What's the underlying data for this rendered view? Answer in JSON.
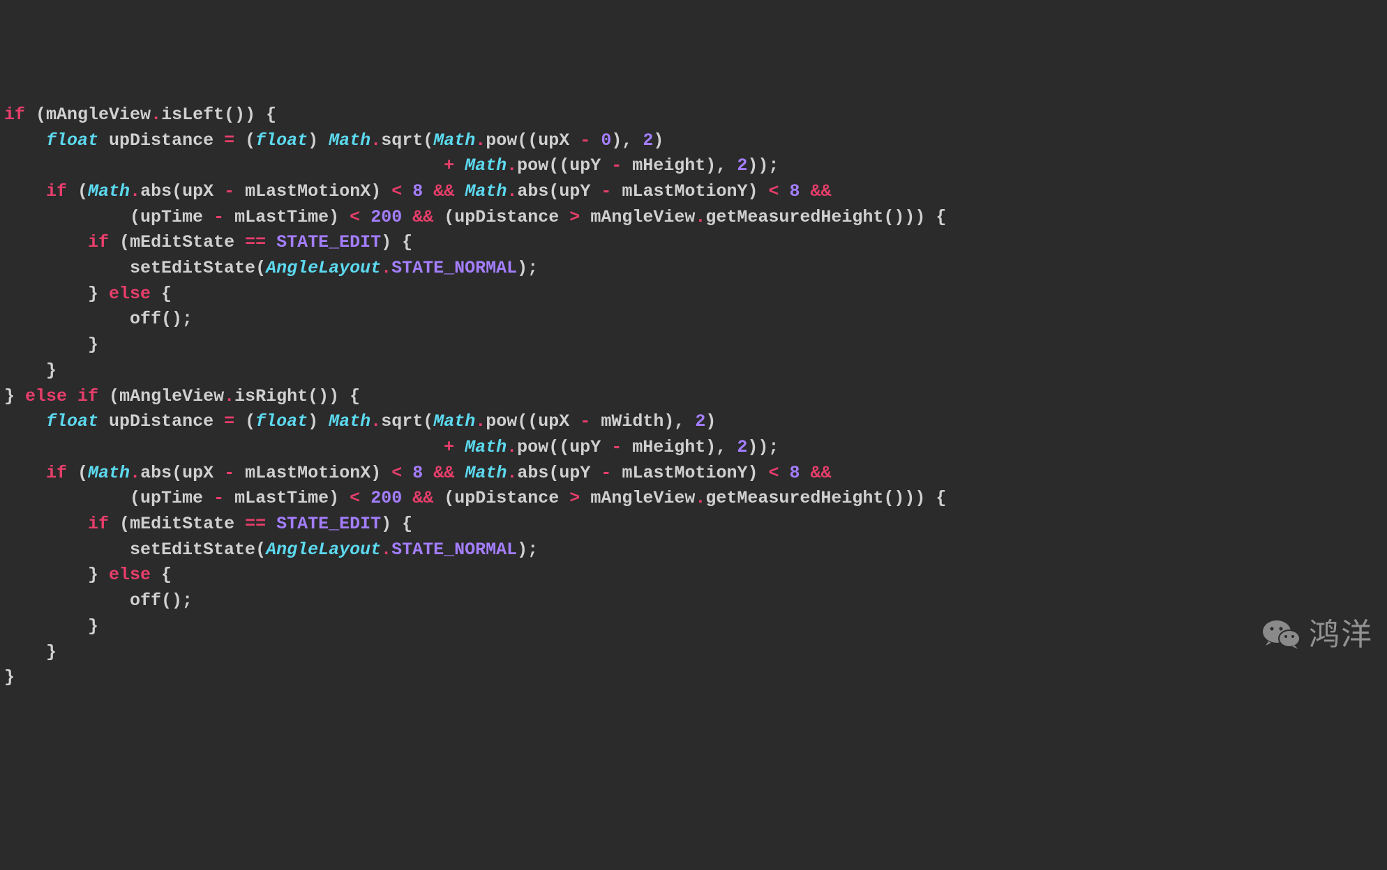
{
  "code": {
    "lines": [
      [
        {
          "c": "kw",
          "t": "if"
        },
        {
          "c": "pn",
          "t": " ("
        },
        {
          "c": "id",
          "t": "mAngleView"
        },
        {
          "c": "op",
          "t": "."
        },
        {
          "c": "id",
          "t": "isLeft"
        },
        {
          "c": "pn",
          "t": "()) {"
        }
      ],
      [
        {
          "c": "pn",
          "t": "    "
        },
        {
          "c": "kwit",
          "t": "float"
        },
        {
          "c": "pn",
          "t": " "
        },
        {
          "c": "id",
          "t": "upDistance"
        },
        {
          "c": "pn",
          "t": " "
        },
        {
          "c": "op",
          "t": "="
        },
        {
          "c": "pn",
          "t": " ("
        },
        {
          "c": "kwit",
          "t": "float"
        },
        {
          "c": "pn",
          "t": ") "
        },
        {
          "c": "kwit",
          "t": "Math"
        },
        {
          "c": "op",
          "t": "."
        },
        {
          "c": "id",
          "t": "sqrt"
        },
        {
          "c": "pn",
          "t": "("
        },
        {
          "c": "kwit",
          "t": "Math"
        },
        {
          "c": "op",
          "t": "."
        },
        {
          "c": "id",
          "t": "pow"
        },
        {
          "c": "pn",
          "t": "(("
        },
        {
          "c": "id",
          "t": "upX"
        },
        {
          "c": "pn",
          "t": " "
        },
        {
          "c": "op",
          "t": "-"
        },
        {
          "c": "pn",
          "t": " "
        },
        {
          "c": "num",
          "t": "0"
        },
        {
          "c": "pn",
          "t": "), "
        },
        {
          "c": "num",
          "t": "2"
        },
        {
          "c": "pn",
          "t": ")"
        }
      ],
      [
        {
          "c": "pn",
          "t": "                                          "
        },
        {
          "c": "op",
          "t": "+"
        },
        {
          "c": "pn",
          "t": " "
        },
        {
          "c": "kwit",
          "t": "Math"
        },
        {
          "c": "op",
          "t": "."
        },
        {
          "c": "id",
          "t": "pow"
        },
        {
          "c": "pn",
          "t": "(("
        },
        {
          "c": "id",
          "t": "upY"
        },
        {
          "c": "pn",
          "t": " "
        },
        {
          "c": "op",
          "t": "-"
        },
        {
          "c": "pn",
          "t": " "
        },
        {
          "c": "id",
          "t": "mHeight"
        },
        {
          "c": "pn",
          "t": "), "
        },
        {
          "c": "num",
          "t": "2"
        },
        {
          "c": "pn",
          "t": "));"
        }
      ],
      [
        {
          "c": "pn",
          "t": "    "
        },
        {
          "c": "kw",
          "t": "if"
        },
        {
          "c": "pn",
          "t": " ("
        },
        {
          "c": "kwit",
          "t": "Math"
        },
        {
          "c": "op",
          "t": "."
        },
        {
          "c": "id",
          "t": "abs"
        },
        {
          "c": "pn",
          "t": "("
        },
        {
          "c": "id",
          "t": "upX"
        },
        {
          "c": "pn",
          "t": " "
        },
        {
          "c": "op",
          "t": "-"
        },
        {
          "c": "pn",
          "t": " "
        },
        {
          "c": "id",
          "t": "mLastMotionX"
        },
        {
          "c": "pn",
          "t": ") "
        },
        {
          "c": "op",
          "t": "<"
        },
        {
          "c": "pn",
          "t": " "
        },
        {
          "c": "num",
          "t": "8"
        },
        {
          "c": "pn",
          "t": " "
        },
        {
          "c": "op",
          "t": "&&"
        },
        {
          "c": "pn",
          "t": " "
        },
        {
          "c": "kwit",
          "t": "Math"
        },
        {
          "c": "op",
          "t": "."
        },
        {
          "c": "id",
          "t": "abs"
        },
        {
          "c": "pn",
          "t": "("
        },
        {
          "c": "id",
          "t": "upY"
        },
        {
          "c": "pn",
          "t": " "
        },
        {
          "c": "op",
          "t": "-"
        },
        {
          "c": "pn",
          "t": " "
        },
        {
          "c": "id",
          "t": "mLastMotionY"
        },
        {
          "c": "pn",
          "t": ") "
        },
        {
          "c": "op",
          "t": "<"
        },
        {
          "c": "pn",
          "t": " "
        },
        {
          "c": "num",
          "t": "8"
        },
        {
          "c": "pn",
          "t": " "
        },
        {
          "c": "op",
          "t": "&&"
        }
      ],
      [
        {
          "c": "pn",
          "t": "            ("
        },
        {
          "c": "id",
          "t": "upTime"
        },
        {
          "c": "pn",
          "t": " "
        },
        {
          "c": "op",
          "t": "-"
        },
        {
          "c": "pn",
          "t": " "
        },
        {
          "c": "id",
          "t": "mLastTime"
        },
        {
          "c": "pn",
          "t": ") "
        },
        {
          "c": "op",
          "t": "<"
        },
        {
          "c": "pn",
          "t": " "
        },
        {
          "c": "num",
          "t": "200"
        },
        {
          "c": "pn",
          "t": " "
        },
        {
          "c": "op",
          "t": "&&"
        },
        {
          "c": "pn",
          "t": " ("
        },
        {
          "c": "id",
          "t": "upDistance"
        },
        {
          "c": "pn",
          "t": " "
        },
        {
          "c": "op",
          "t": ">"
        },
        {
          "c": "pn",
          "t": " "
        },
        {
          "c": "id",
          "t": "mAngleView"
        },
        {
          "c": "op",
          "t": "."
        },
        {
          "c": "id",
          "t": "getMeasuredHeight"
        },
        {
          "c": "pn",
          "t": "())) {"
        }
      ],
      [
        {
          "c": "pn",
          "t": "        "
        },
        {
          "c": "kw",
          "t": "if"
        },
        {
          "c": "pn",
          "t": " ("
        },
        {
          "c": "id",
          "t": "mEditState"
        },
        {
          "c": "pn",
          "t": " "
        },
        {
          "c": "op",
          "t": "=="
        },
        {
          "c": "pn",
          "t": " "
        },
        {
          "c": "const",
          "t": "STATE_EDIT"
        },
        {
          "c": "pn",
          "t": ") {"
        }
      ],
      [
        {
          "c": "pn",
          "t": "            "
        },
        {
          "c": "id",
          "t": "setEditState"
        },
        {
          "c": "pn",
          "t": "("
        },
        {
          "c": "kwit",
          "t": "AngleLayout"
        },
        {
          "c": "op",
          "t": "."
        },
        {
          "c": "const",
          "t": "STATE_NORMAL"
        },
        {
          "c": "pn",
          "t": ");"
        }
      ],
      [
        {
          "c": "pn",
          "t": "        } "
        },
        {
          "c": "kw",
          "t": "else"
        },
        {
          "c": "pn",
          "t": " {"
        }
      ],
      [
        {
          "c": "pn",
          "t": "            "
        },
        {
          "c": "id",
          "t": "off"
        },
        {
          "c": "pn",
          "t": "();"
        }
      ],
      [
        {
          "c": "pn",
          "t": "        }"
        }
      ],
      [
        {
          "c": "pn",
          "t": "    }"
        }
      ],
      [
        {
          "c": "pn",
          "t": "} "
        },
        {
          "c": "kw",
          "t": "else if"
        },
        {
          "c": "pn",
          "t": " ("
        },
        {
          "c": "id",
          "t": "mAngleView"
        },
        {
          "c": "op",
          "t": "."
        },
        {
          "c": "id",
          "t": "isRight"
        },
        {
          "c": "pn",
          "t": "()) {"
        }
      ],
      [
        {
          "c": "pn",
          "t": "    "
        },
        {
          "c": "kwit",
          "t": "float"
        },
        {
          "c": "pn",
          "t": " "
        },
        {
          "c": "id",
          "t": "upDistance"
        },
        {
          "c": "pn",
          "t": " "
        },
        {
          "c": "op",
          "t": "="
        },
        {
          "c": "pn",
          "t": " ("
        },
        {
          "c": "kwit",
          "t": "float"
        },
        {
          "c": "pn",
          "t": ") "
        },
        {
          "c": "kwit",
          "t": "Math"
        },
        {
          "c": "op",
          "t": "."
        },
        {
          "c": "id",
          "t": "sqrt"
        },
        {
          "c": "pn",
          "t": "("
        },
        {
          "c": "kwit",
          "t": "Math"
        },
        {
          "c": "op",
          "t": "."
        },
        {
          "c": "id",
          "t": "pow"
        },
        {
          "c": "pn",
          "t": "(("
        },
        {
          "c": "id",
          "t": "upX"
        },
        {
          "c": "pn",
          "t": " "
        },
        {
          "c": "op",
          "t": "-"
        },
        {
          "c": "pn",
          "t": " "
        },
        {
          "c": "id",
          "t": "mWidth"
        },
        {
          "c": "pn",
          "t": "), "
        },
        {
          "c": "num",
          "t": "2"
        },
        {
          "c": "pn",
          "t": ")"
        }
      ],
      [
        {
          "c": "pn",
          "t": "                                          "
        },
        {
          "c": "op",
          "t": "+"
        },
        {
          "c": "pn",
          "t": " "
        },
        {
          "c": "kwit",
          "t": "Math"
        },
        {
          "c": "op",
          "t": "."
        },
        {
          "c": "id",
          "t": "pow"
        },
        {
          "c": "pn",
          "t": "(("
        },
        {
          "c": "id",
          "t": "upY"
        },
        {
          "c": "pn",
          "t": " "
        },
        {
          "c": "op",
          "t": "-"
        },
        {
          "c": "pn",
          "t": " "
        },
        {
          "c": "id",
          "t": "mHeight"
        },
        {
          "c": "pn",
          "t": "), "
        },
        {
          "c": "num",
          "t": "2"
        },
        {
          "c": "pn",
          "t": "));"
        }
      ],
      [
        {
          "c": "pn",
          "t": "    "
        },
        {
          "c": "kw",
          "t": "if"
        },
        {
          "c": "pn",
          "t": " ("
        },
        {
          "c": "kwit",
          "t": "Math"
        },
        {
          "c": "op",
          "t": "."
        },
        {
          "c": "id",
          "t": "abs"
        },
        {
          "c": "pn",
          "t": "("
        },
        {
          "c": "id",
          "t": "upX"
        },
        {
          "c": "pn",
          "t": " "
        },
        {
          "c": "op",
          "t": "-"
        },
        {
          "c": "pn",
          "t": " "
        },
        {
          "c": "id",
          "t": "mLastMotionX"
        },
        {
          "c": "pn",
          "t": ") "
        },
        {
          "c": "op",
          "t": "<"
        },
        {
          "c": "pn",
          "t": " "
        },
        {
          "c": "num",
          "t": "8"
        },
        {
          "c": "pn",
          "t": " "
        },
        {
          "c": "op",
          "t": "&&"
        },
        {
          "c": "pn",
          "t": " "
        },
        {
          "c": "kwit",
          "t": "Math"
        },
        {
          "c": "op",
          "t": "."
        },
        {
          "c": "id",
          "t": "abs"
        },
        {
          "c": "pn",
          "t": "("
        },
        {
          "c": "id",
          "t": "upY"
        },
        {
          "c": "pn",
          "t": " "
        },
        {
          "c": "op",
          "t": "-"
        },
        {
          "c": "pn",
          "t": " "
        },
        {
          "c": "id",
          "t": "mLastMotionY"
        },
        {
          "c": "pn",
          "t": ") "
        },
        {
          "c": "op",
          "t": "<"
        },
        {
          "c": "pn",
          "t": " "
        },
        {
          "c": "num",
          "t": "8"
        },
        {
          "c": "pn",
          "t": " "
        },
        {
          "c": "op",
          "t": "&&"
        }
      ],
      [
        {
          "c": "pn",
          "t": "            ("
        },
        {
          "c": "id",
          "t": "upTime"
        },
        {
          "c": "pn",
          "t": " "
        },
        {
          "c": "op",
          "t": "-"
        },
        {
          "c": "pn",
          "t": " "
        },
        {
          "c": "id",
          "t": "mLastTime"
        },
        {
          "c": "pn",
          "t": ") "
        },
        {
          "c": "op",
          "t": "<"
        },
        {
          "c": "pn",
          "t": " "
        },
        {
          "c": "num",
          "t": "200"
        },
        {
          "c": "pn",
          "t": " "
        },
        {
          "c": "op",
          "t": "&&"
        },
        {
          "c": "pn",
          "t": " ("
        },
        {
          "c": "id",
          "t": "upDistance"
        },
        {
          "c": "pn",
          "t": " "
        },
        {
          "c": "op",
          "t": ">"
        },
        {
          "c": "pn",
          "t": " "
        },
        {
          "c": "id",
          "t": "mAngleView"
        },
        {
          "c": "op",
          "t": "."
        },
        {
          "c": "id",
          "t": "getMeasuredHeight"
        },
        {
          "c": "pn",
          "t": "())) {"
        }
      ],
      [
        {
          "c": "pn",
          "t": "        "
        },
        {
          "c": "kw",
          "t": "if"
        },
        {
          "c": "pn",
          "t": " ("
        },
        {
          "c": "id",
          "t": "mEditState"
        },
        {
          "c": "pn",
          "t": " "
        },
        {
          "c": "op",
          "t": "=="
        },
        {
          "c": "pn",
          "t": " "
        },
        {
          "c": "const",
          "t": "STATE_EDIT"
        },
        {
          "c": "pn",
          "t": ") {"
        }
      ],
      [
        {
          "c": "pn",
          "t": "            "
        },
        {
          "c": "id",
          "t": "setEditState"
        },
        {
          "c": "pn",
          "t": "("
        },
        {
          "c": "kwit",
          "t": "AngleLayout"
        },
        {
          "c": "op",
          "t": "."
        },
        {
          "c": "const",
          "t": "STATE_NORMAL"
        },
        {
          "c": "pn",
          "t": ");"
        }
      ],
      [
        {
          "c": "pn",
          "t": "        } "
        },
        {
          "c": "kw",
          "t": "else"
        },
        {
          "c": "pn",
          "t": " {"
        }
      ],
      [
        {
          "c": "pn",
          "t": "            "
        },
        {
          "c": "id",
          "t": "off"
        },
        {
          "c": "pn",
          "t": "();"
        }
      ],
      [
        {
          "c": "pn",
          "t": "        }"
        }
      ],
      [
        {
          "c": "pn",
          "t": "    }"
        }
      ],
      [
        {
          "c": "pn",
          "t": "}"
        }
      ]
    ]
  },
  "watermark": {
    "text": "鸿洋"
  }
}
